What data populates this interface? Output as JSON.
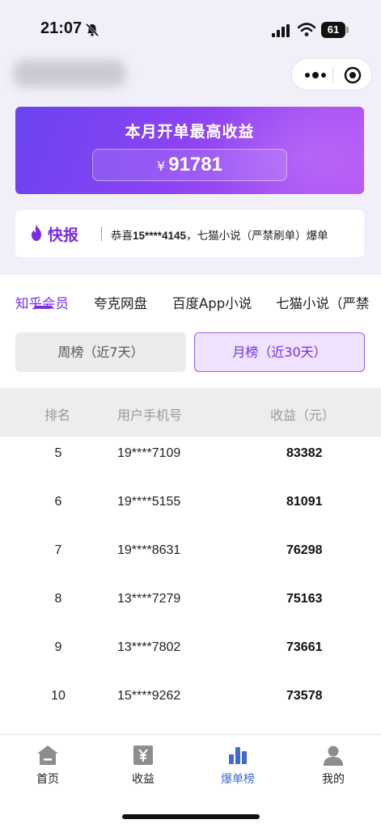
{
  "status_bar": {
    "time": "21:07",
    "battery": "61"
  },
  "banner": {
    "title": "本月开单最高收益",
    "currency": "¥",
    "amount": "91781"
  },
  "flash": {
    "label": "快报",
    "prefix": "恭喜",
    "phone": "15****4145",
    "suffix": "，七猫小说（严禁刷单）爆单"
  },
  "tabs": [
    {
      "label": "知乎会员"
    },
    {
      "label": "夸克网盘"
    },
    {
      "label": "百度App小说"
    },
    {
      "label": "七猫小说（严禁"
    }
  ],
  "period": {
    "week": "周榜（近7天）",
    "month": "月榜（近30天）"
  },
  "table": {
    "headers": {
      "rank": "排名",
      "phone": "用户手机号",
      "income": "收益（元）"
    },
    "rows": [
      {
        "rank": "5",
        "phone": "19****7109",
        "income": "83382"
      },
      {
        "rank": "6",
        "phone": "19****5155",
        "income": "81091"
      },
      {
        "rank": "7",
        "phone": "19****8631",
        "income": "76298"
      },
      {
        "rank": "8",
        "phone": "13****7279",
        "income": "75163"
      },
      {
        "rank": "9",
        "phone": "13****7802",
        "income": "73661"
      },
      {
        "rank": "10",
        "phone": "15****9262",
        "income": "73578"
      }
    ]
  },
  "bottom_nav": [
    {
      "label": "首页",
      "icon": "home-icon"
    },
    {
      "label": "收益",
      "icon": "yen-icon"
    },
    {
      "label": "爆单榜",
      "icon": "bar-chart-icon"
    },
    {
      "label": "我的",
      "icon": "user-icon"
    }
  ],
  "colors": {
    "accent": "#7a2ee0",
    "nav_active": "#3f68d8",
    "banner_start": "#6b43f0",
    "banner_end": "#b653f5"
  }
}
